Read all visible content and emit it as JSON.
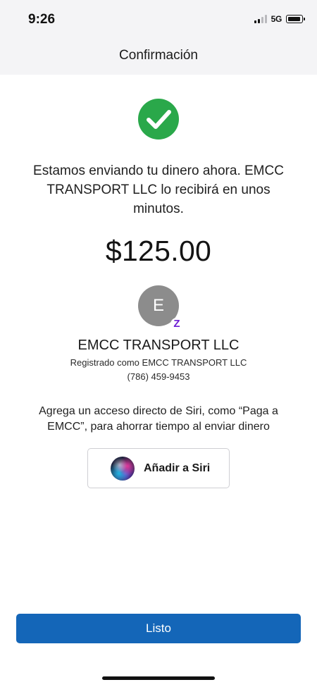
{
  "status_bar": {
    "time": "9:26",
    "network": "5G",
    "network_icon": "signal-bars-icon",
    "battery_icon": "battery-icon"
  },
  "nav": {
    "title": "Confirmación"
  },
  "confirmation": {
    "success_icon": "checkmark-circle-icon",
    "success_color": "#2aa84a",
    "message": "Estamos enviando tu dinero ahora. EMCC TRANSPORT LLC lo recibirá en unos minutos.",
    "amount": "$125.00"
  },
  "recipient": {
    "avatar_initial": "E",
    "badge_glyph": "Z",
    "badge_icon": "zelle-icon",
    "name": "EMCC TRANSPORT LLC",
    "registered_as": "Registrado como EMCC TRANSPORT LLC",
    "phone": "(786) 459-9453"
  },
  "siri": {
    "prompt": "Agrega un acceso directo de Siri, como “Paga a EMCC”, para ahorrar tiempo al enviar dinero",
    "button_label": "Añadir a Siri",
    "button_icon": "siri-icon"
  },
  "footer": {
    "done_label": "Listo",
    "accent_color": "#1466b8"
  }
}
